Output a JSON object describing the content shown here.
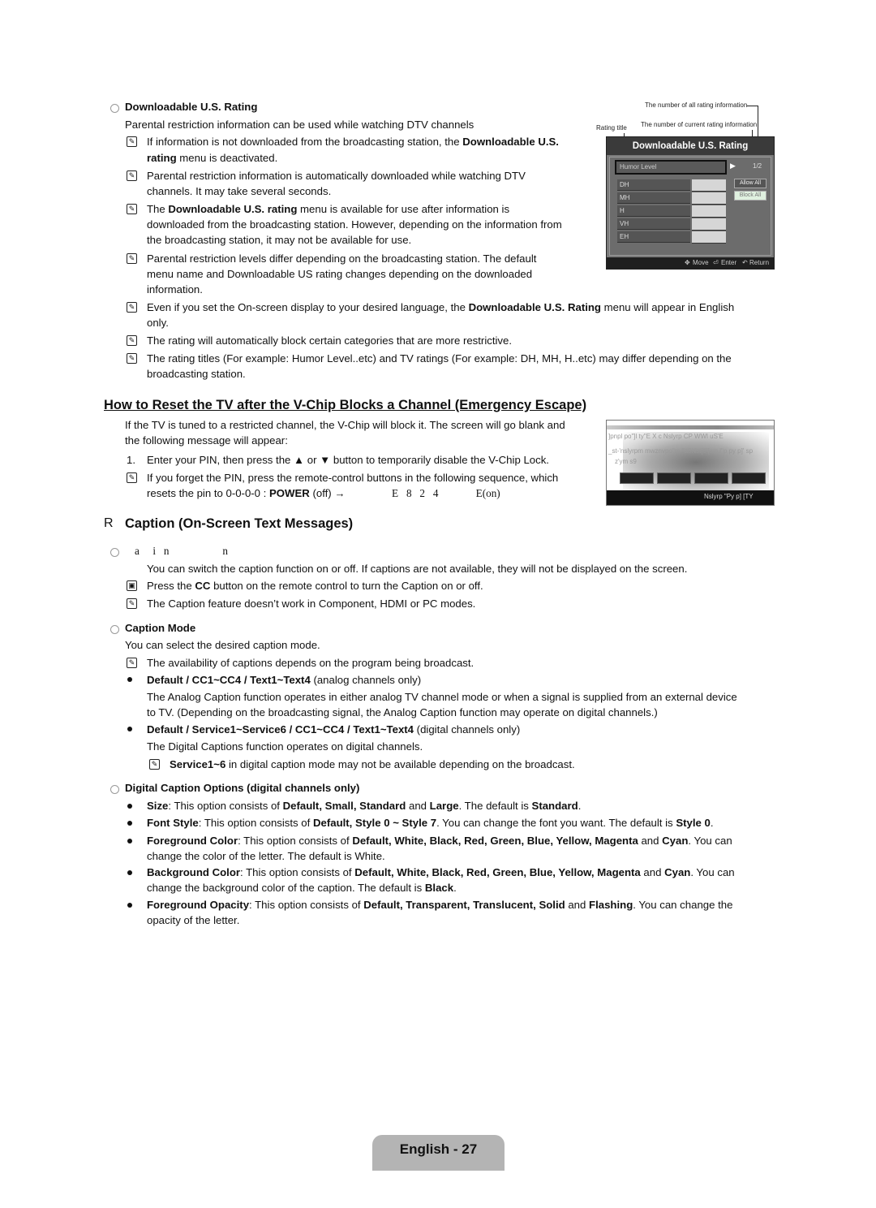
{
  "section1": {
    "heading": "Downloadable U.S. Rating",
    "intro": "Parental restriction information can be used while watching DTV channels",
    "notes": [
      {
        "pre": "If information is not downloaded from the broadcasting station, the ",
        "bold": "Downloadable U.S.",
        "post": ""
      },
      {
        "line2_bold": "rating",
        "line2_post": " menu is deactivated."
      }
    ],
    "n1_l1_pre": "If information is not downloaded from the broadcasting station, the ",
    "n1_l1_bold": "Downloadable U.S.",
    "n1_l2_bold": "rating",
    "n1_l2_post": " menu is deactivated.",
    "n2_l1": "Parental restriction information is automatically downloaded while watching DTV",
    "n2_l2": "channels. It may take several seconds.",
    "n3_l1_pre": "The ",
    "n3_l1_bold": "Downloadable U.S. rating",
    "n3_l1_post": " menu is available for use after information is",
    "n3_l2": "downloaded from the broadcasting station. However, depending on the information from",
    "n3_l3": "the broadcasting station, it may not be available for use.",
    "n4_l1": "Parental restriction levels differ depending on the broadcasting station. The default",
    "n4_l2": "menu name and Downloadable US rating changes depending on the downloaded",
    "n4_l3": "information.",
    "n5_l1_pre": "Even if you set the On-screen display to your desired language, the ",
    "n5_l1_bold": "Downloadable U.S. Rating",
    "n5_l1_post": " menu will appear in English",
    "n5_l2": "only.",
    "n6": "The rating will automatically block certain categories that are more restrictive.",
    "n7_l1": "The rating titles (For example: Humor Level..etc) and TV ratings (For example: DH, MH, H..etc) may differ depending on the",
    "n7_l2": "broadcasting station."
  },
  "menu": {
    "label_all": "The number of all rating information",
    "label_current": "The number of current rating information",
    "label_title": "Rating title",
    "title": "Downloadable U.S. Rating",
    "rating_title": "Humor Level",
    "page": "1/2",
    "rows": [
      "DH",
      "MH",
      "H",
      "VH",
      "EH"
    ],
    "allow_all": "Allow All",
    "block_all": "Block All",
    "foot_move": "Move",
    "foot_enter": "Enter",
    "foot_return": "Return"
  },
  "section2": {
    "heading": "How to Reset the TV after the V-Chip Blocks a Channel (Emergency Escape)",
    "p_l1": "If the TV is tuned to a restricted channel, the V-Chip will block it. The screen will go blank and",
    "p_l2": "the following message will appear:",
    "step_num": "1.",
    "step": "Enter your PIN, then press the ▲ or ▼ button to temporarily disable the V-Chip Lock.",
    "note_l1": "If you forget the PIN, press the remote-control buttons in the following sequence, which",
    "note_l2_pre": "resets the pin to 0-0-0-0 : ",
    "note_l2_bold": "POWER",
    "note_l2_post": " (off) →",
    "note_seq": "E   8   2   4              E(on)",
    "img2_l1": "]pnpl po\"]l ty\"E X   c Nslyrp CP WWl uS'E",
    "img2_l2": "_st-'nslyrpm   mwznvpo\"m \"a8Nst[9'[wp l\"p py p]' sp",
    "img2_l3": "z'ym  s9",
    "img2_foot": "Nslyrp    \"Py p] [TY"
  },
  "section3": {
    "marker": "R",
    "heading": "Caption (On-Screen Text Messages)",
    "sub1_garbled": "a     i   n                    n",
    "p1": "You can switch the caption function on or off. If captions are not available, they will not be displayed on the screen.",
    "n1_pre": "Press the ",
    "n1_bold": "CC",
    "n1_post": " button on the remote control to turn the Caption on or off.",
    "n2": "The Caption feature doesn’t work in Component, HDMI or PC modes.",
    "sub2": "Caption Mode",
    "p2": "You can select the desired caption mode.",
    "n3": "The availability of captions depends on the program being broadcast.",
    "b1_bold": "Default / CC1~CC4 / Text1~Text4",
    "b1_post": " (analog channels only)",
    "b1_d1": "The Analog Caption function operates in either analog TV channel mode or when a signal is supplied from an external device",
    "b1_d2": "to TV. (Depending on the broadcasting signal, the Analog Caption function may operate on digital channels.)",
    "b2_bold": "Default / Service1~Service6 / CC1~CC4 / Text1~Text4",
    "b2_post": " (digital channels only)",
    "b2_d1": "The Digital Captions function operates on digital channels.",
    "n4_bold": "Service1~6",
    "n4_post": " in digital caption mode may not be available depending on the broadcast.",
    "sub3": "Digital Caption Options (digital channels only)",
    "o1_b": "Size",
    "o1_t": ": This option consists of ",
    "o1_v": "Default, Small, Standard",
    "o1_t2": " and ",
    "o1_v2": "Large",
    "o1_t3": ". The default is ",
    "o1_v3": "Standard",
    "o2_b": "Font Style",
    "o2_t": ": This option consists of ",
    "o2_v": "Default, Style 0 ~ Style 7",
    "o2_t2": ". You can change the font you want. The default is ",
    "o2_v2": "Style 0",
    "o3_b": "Foreground Color",
    "o3_t": ": This option consists of ",
    "o3_v": "Default, White, Black, Red, Green, Blue, Yellow, Magenta",
    "o3_t2": " and ",
    "o3_v2": "Cyan",
    "o3_t3": ". You can",
    "o3_l2": "change the color of the letter. The default is White.",
    "o4_b": "Background Color",
    "o4_t": ": This option consists of ",
    "o4_v": "Default, White, Black, Red, Green, Blue, Yellow, Magenta",
    "o4_t2": " and ",
    "o4_v2": "Cyan",
    "o4_t3": ". You can",
    "o4_l2_pre": "change the background color of the caption. The default is ",
    "o4_l2_bold": "Black",
    "o5_b": "Foreground Opacity",
    "o5_t": ": This option consists of ",
    "o5_v": "Default, Transparent, Translucent, Solid",
    "o5_t2": " and ",
    "o5_v2": "Flashing",
    "o5_t3": ". You can change the",
    "o5_l2": "opacity of the letter."
  },
  "footer": {
    "page_label": "English - 27"
  }
}
